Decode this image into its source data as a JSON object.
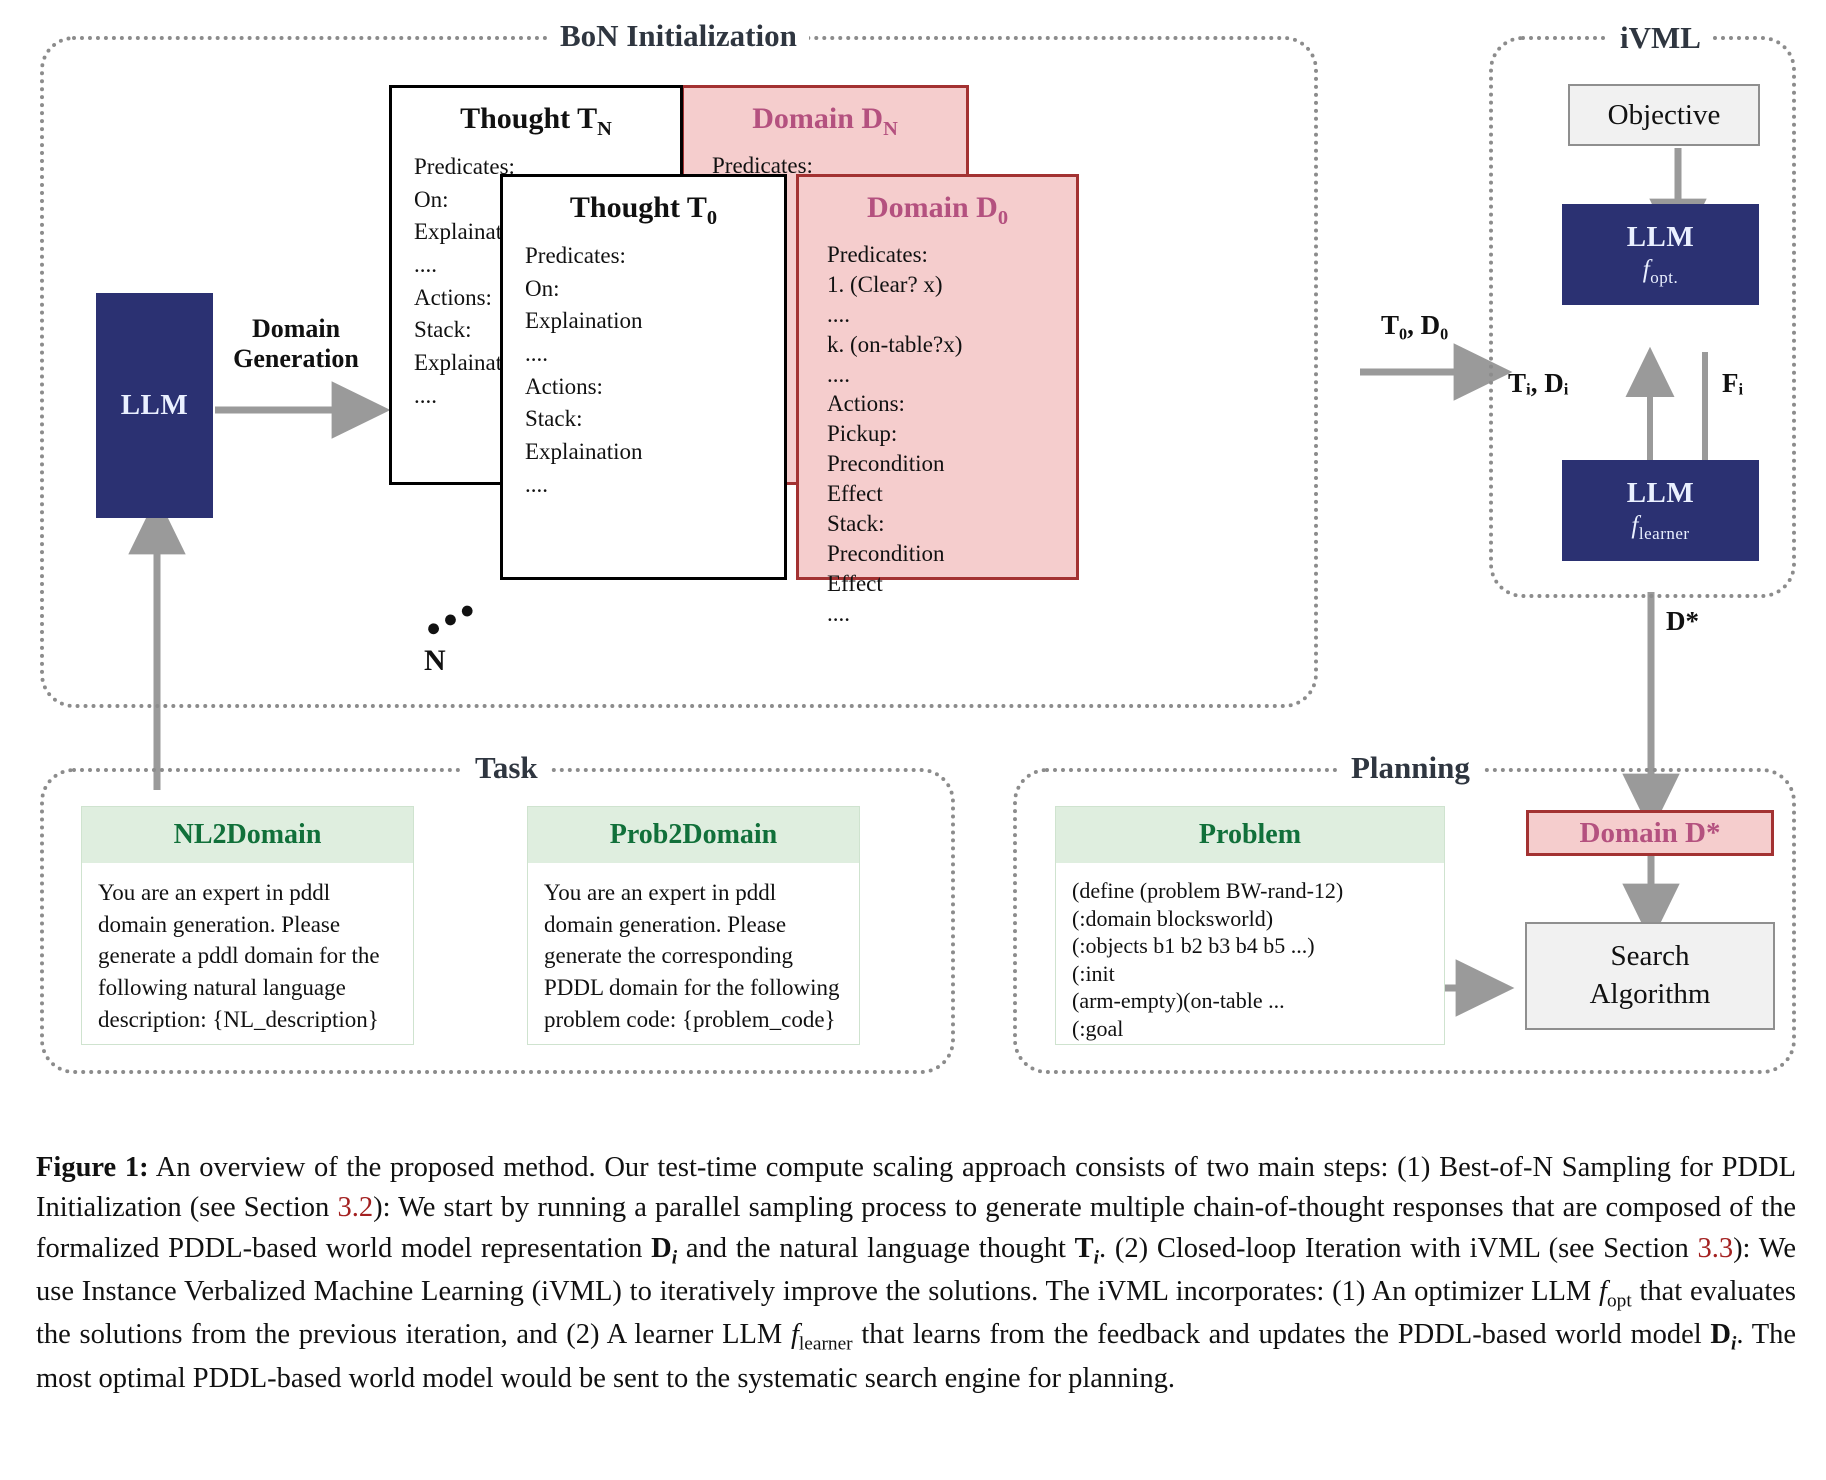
{
  "figure": {
    "panels": {
      "bon": "BoN Initialization",
      "ivml": "iVML",
      "task": "Task",
      "planning": "Planning"
    },
    "left": {
      "llm_label": "LLM",
      "arrow_label_line1": "Domain",
      "arrow_label_line2": "Generation",
      "n_dots": "•••",
      "n_label": "N"
    },
    "thought_n": {
      "title_prefix": "Thought",
      "title_symbol": "T",
      "title_sub": "N",
      "lines": [
        "Predicates:",
        "On:",
        "Explaination",
        "....",
        "Actions:",
        "Stack:",
        "Explaination",
        "...."
      ]
    },
    "domain_n": {
      "title_prefix": "Domain",
      "title_symbol": "D",
      "title_sub": "N",
      "lines": [
        "Predicates:"
      ]
    },
    "thought_0": {
      "title_prefix": "Thought",
      "title_symbol": "T",
      "title_sub": "0",
      "lines": [
        "Predicates:",
        "On:",
        "Explaination",
        "....",
        "Actions:",
        "Stack:",
        "Explaination",
        "...."
      ]
    },
    "domain_0": {
      "title_prefix": "Domain",
      "title_symbol": "D",
      "title_sub": "0",
      "lines": [
        "Predicates:",
        "1. (Clear? x)",
        "....",
        "k. (on-table?x)",
        "....",
        "Actions:",
        "Pickup:",
        "Precondition",
        "Effect",
        "Stack:",
        "Precondition",
        "Effect",
        "...."
      ]
    },
    "edges": {
      "t0d0": "T₀, D₀",
      "tidi": "Tᵢ, Dᵢ",
      "fi": "Fᵢ",
      "dstar": "D*"
    },
    "ivml": {
      "objective": "Objective",
      "optimizer_name": "LLM",
      "optimizer_fn": "f",
      "optimizer_sub": "opt.",
      "learner_name": "LLM",
      "learner_fn": "f",
      "learner_sub": "learner"
    },
    "task": {
      "nl2domain": {
        "title": "NL2Domain",
        "body": "You are an expert in pddl domain generation. Please generate a pddl domain for the following natural language description: {NL_description}"
      },
      "prob2domain": {
        "title": "Prob2Domain",
        "body": "You are an expert in pddl domain generation. Please generate the corresponding PDDL domain for the following problem code: {problem_code}"
      }
    },
    "planning": {
      "problem": {
        "title": "Problem",
        "code_lines": [
          "(define (problem BW-rand-12)",
          "(:domain blocksworld)",
          "(:objects b1 b2 b3 b4 b5 ...)",
          "(:init",
          "(arm-empty)(on-table ...",
          "(:goal"
        ]
      },
      "domain_star": "Domain D*",
      "search_line1": "Search",
      "search_line2": "Algorithm"
    },
    "colors": {
      "llm_navy": "#2b3172",
      "domain_pink_fill": "#f5cdcd",
      "domain_pink_border": "#a33232",
      "domain_title_mauve": "#b4517f",
      "task_green_header": "#dfeedf",
      "task_green_text": "#11703a",
      "panel_dotted_grey": "#8c8c8c",
      "arrow_grey": "#9a9a9a",
      "section_ref_red": "#a32020"
    }
  },
  "caption": {
    "label": "Figure 1:",
    "p1": "An overview of the proposed method. Our test-time compute scaling approach consists of two main steps: (1) Best-of-N Sampling for PDDL Initialization (see Section ",
    "sec1": "3.2",
    "p2": "): We start by running a parallel sampling process to generate multiple chain-of-thought responses that are composed of the formalized PDDL-based world model representation ",
    "d_i": "D",
    "p3": " and the natural language thought ",
    "t_i": "T",
    "p4": ". (2) Closed-loop Iteration with iVML (see Section ",
    "sec2": "3.3",
    "p5": "): We use Instance Verbalized Machine Learning (iVML) to iteratively improve the solutions. The iVML incorporates: (1) An optimizer LLM ",
    "f_opt": "f",
    "f_opt_sub": "opt",
    "p6": " that evaluates the solutions from the previous iteration, and (2) A learner LLM ",
    "f_learner": "f",
    "f_learner_sub": "learner",
    "p7": " that learns from the feedback and updates the PDDL-based world model ",
    "d_i2": "D",
    "p8": ". The most optimal PDDL-based world model would be sent to the systematic search engine for planning."
  }
}
